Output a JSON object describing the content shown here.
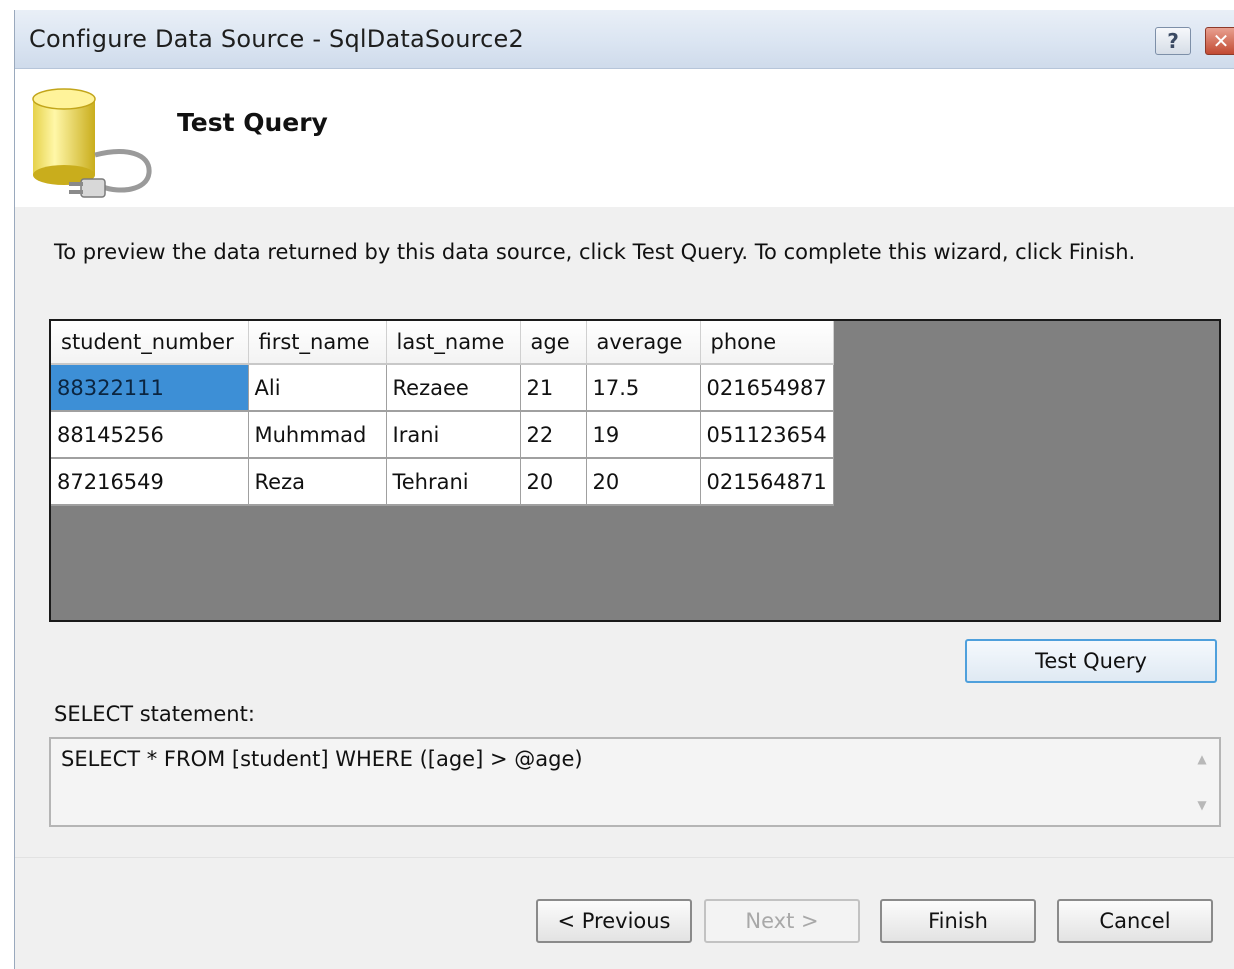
{
  "window": {
    "title": "Configure Data Source - SqlDataSource2",
    "help_glyph": "?",
    "close_glyph": "✕"
  },
  "header": {
    "title": "Test Query",
    "icon": "database-plug-icon"
  },
  "instructions": "To preview the data returned by this data source, click Test Query. To complete this wizard, click Finish.",
  "grid": {
    "columns": [
      "student_number",
      "first_name",
      "last_name",
      "age",
      "average",
      "phone"
    ],
    "rows": [
      [
        "88322111",
        "Ali",
        "Rezaee",
        "21",
        "17.5",
        "021654987"
      ],
      [
        "88145256",
        "Muhmmad",
        "Irani",
        "22",
        "19",
        "051123654"
      ],
      [
        "87216549",
        "Reza",
        "Tehrani",
        "20",
        "20",
        "021564871"
      ]
    ],
    "selected_cell_color": "#3d8fd6",
    "background_color": "#808080"
  },
  "test_query_button": "Test Query",
  "select_label": "SELECT statement:",
  "sql": "SELECT * FROM [student] WHERE ([age] > @age)",
  "footer": {
    "previous_label": "< Previous",
    "next_label": "Next >",
    "finish_label": "Finish",
    "cancel_label": "Cancel"
  },
  "colors": {
    "title_bar": "#dbe5f2",
    "dialog_background": "#f0f0f0",
    "focus_border": "#4fa0dc"
  }
}
